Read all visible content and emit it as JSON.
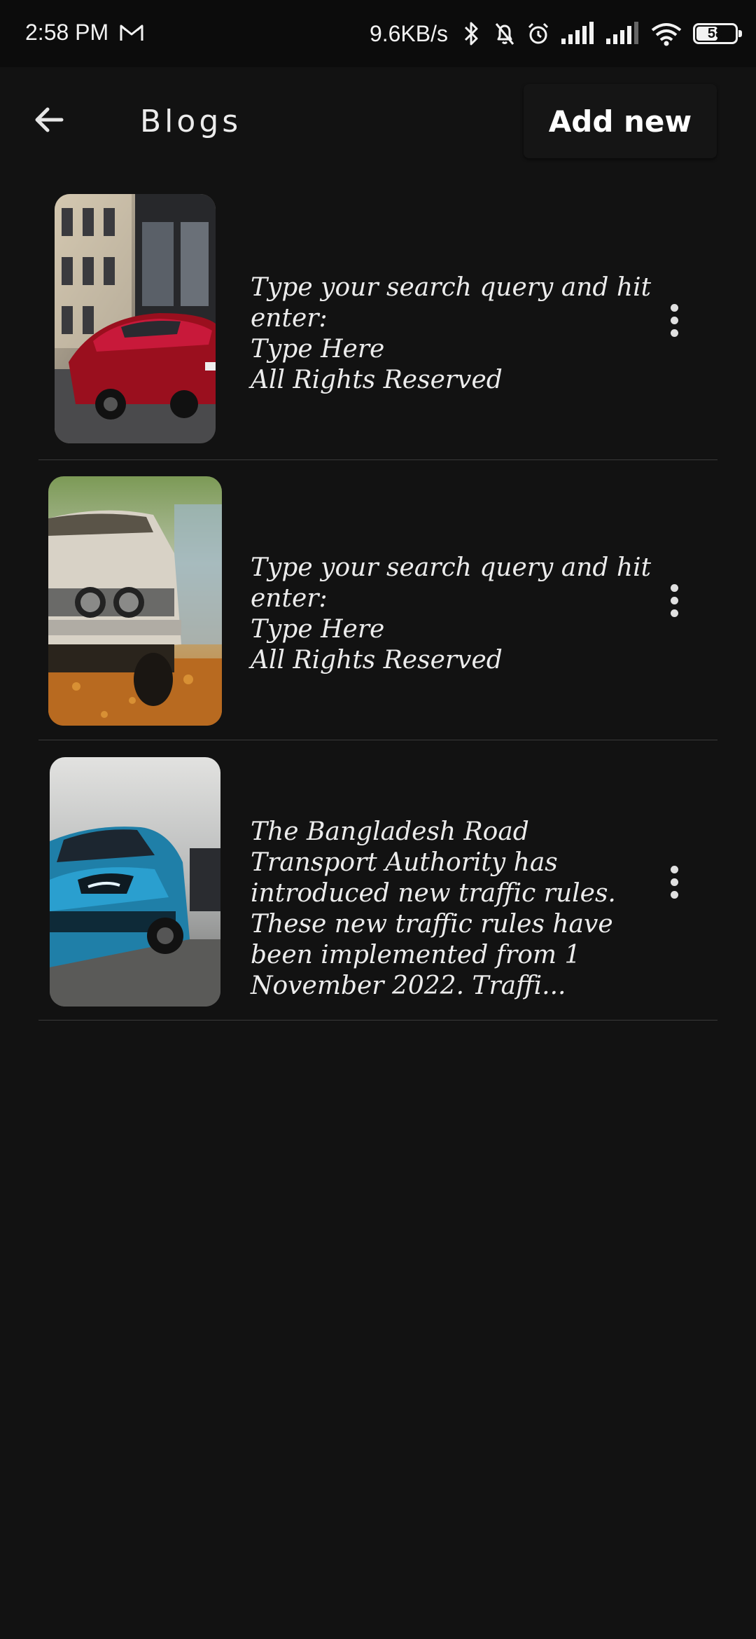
{
  "status_bar": {
    "time": "2:58 PM",
    "net_speed": "9.6KB/s",
    "battery": 58,
    "battery_text": "58",
    "icons": [
      "gmail-icon",
      "bluetooth-icon",
      "bell-off-icon",
      "alarm-icon",
      "signal-icon",
      "signal-icon",
      "wifi-icon",
      "battery-icon"
    ]
  },
  "app_bar": {
    "back_icon": "arrow-left-icon",
    "title": "Blogs",
    "add_new_label": "Add new"
  },
  "blogs": [
    {
      "image": "red-sports-car-photo",
      "lines": [
        "Type your search query and hit enter:",
        "Type Here",
        "All Rights Reserved"
      ],
      "menu_icon": "more-vert-icon"
    },
    {
      "image": "vintage-car-photo",
      "lines": [
        "Type your search query and hit enter:",
        "Type Here",
        "All Rights Reserved"
      ],
      "menu_icon": "more-vert-icon"
    },
    {
      "image": "blue-bmw-photo",
      "lines": [
        "The Bangladesh Road Transport Authority has introduced new traffic rules. These new traffic rules have been implemented from 1 November 2022. Traffi..."
      ],
      "menu_icon": "more-vert-icon"
    }
  ],
  "colors": {
    "background": "#121212",
    "status_bar": "#0c0c0c",
    "divider": "#3a3a3a",
    "text": "#ececec"
  }
}
